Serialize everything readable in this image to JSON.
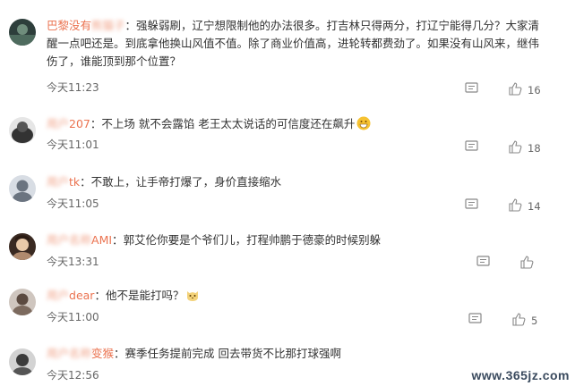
{
  "comments": [
    {
      "user_visible": "巴黎没有",
      "user_obscured": "熊猫子",
      "separator": "：",
      "text": "强躲弱刷，辽宁想限制他的办法很多。打吉林只得两分，打辽宁能得几分？大家清醒一点吧还是。到底拿他换山风值不值。除了商业价值高，进轮转都费劲了。如果没有山风来，继伟伤了，谁能顶到那个位置？",
      "time": "今天11:23",
      "likes": "16"
    },
    {
      "user_visible": "207",
      "user_obscured": "用户",
      "separator": "：",
      "text": "不上场 就不会露馅 老王太太说话的可信度还在飙升",
      "time": "今天11:01",
      "likes": "18"
    },
    {
      "user_visible": "tk",
      "user_obscured": "用户",
      "separator": "：",
      "text": "不敢上，让手帝打爆了，身价直接缩水",
      "time": "今天11:05",
      "likes": "14"
    },
    {
      "user_visible": "AMI",
      "user_obscured": "用户名称",
      "separator": "：",
      "text": "郭艾伦你要是个爷们儿，打程帅鹏于德豪的时候别躲",
      "time": "今天13:31",
      "likes": ""
    },
    {
      "user_visible": "dear",
      "user_obscured": "用户",
      "separator": "：",
      "text": "他不是能打吗？",
      "time": "今天11:00",
      "likes": "5"
    },
    {
      "user_visible": "变猴",
      "user_obscured": "用户名称",
      "separator": "：",
      "text": "赛季任务提前完成 回去带货不比那打球强啊",
      "time": "今天12:56",
      "likes": ""
    }
  ],
  "watermark": {
    "domain": "www.365jz.com"
  },
  "colors": {
    "username": "#eb7350",
    "text": "#333333",
    "muted": "#666666"
  },
  "icons": {
    "reply": "comment-icon",
    "like": "thumbs-up-icon"
  }
}
